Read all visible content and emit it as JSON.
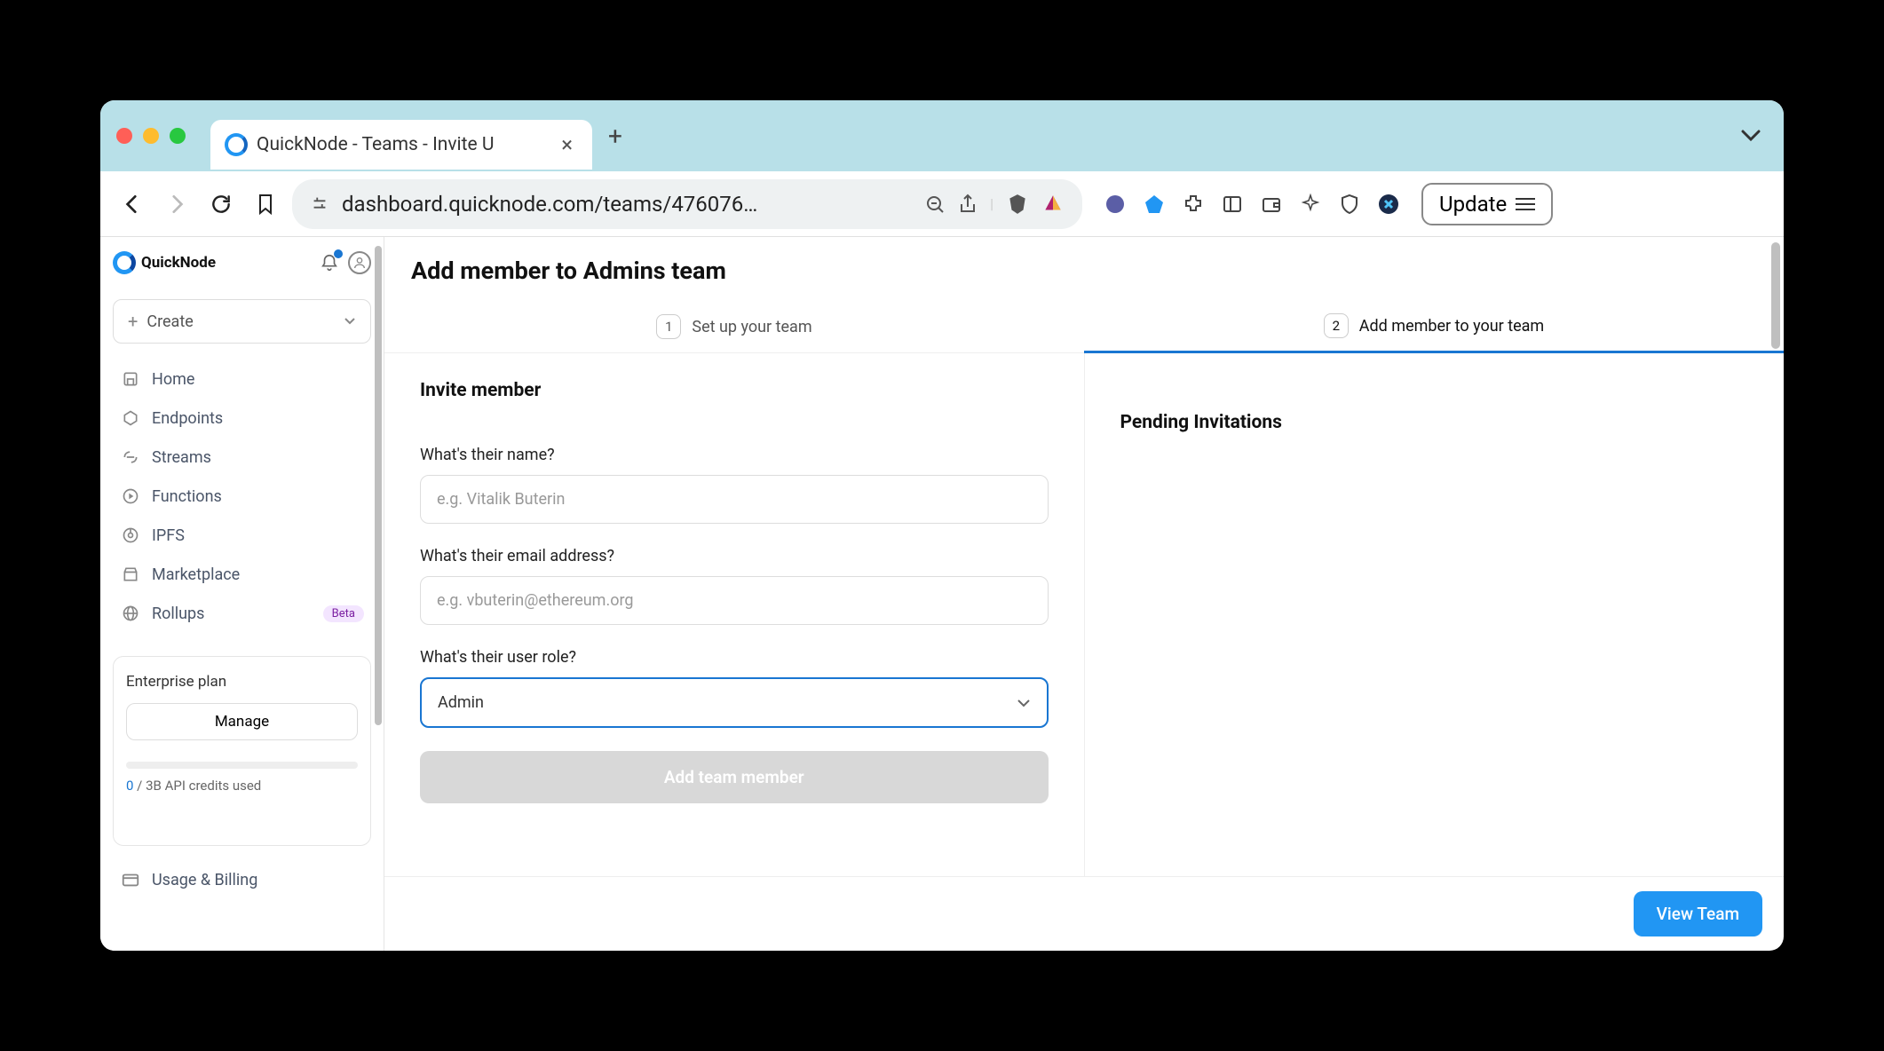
{
  "browser": {
    "tab_title": "QuickNode - Teams - Invite U",
    "url": "dashboard.quicknode.com/teams/476076…",
    "update_label": "Update"
  },
  "sidebar": {
    "brand": "QuickNode",
    "create_label": "Create",
    "nav": [
      {
        "label": "Home",
        "icon": "home"
      },
      {
        "label": "Endpoints",
        "icon": "hexagon"
      },
      {
        "label": "Streams",
        "icon": "stream"
      },
      {
        "label": "Functions",
        "icon": "play"
      },
      {
        "label": "IPFS",
        "icon": "ipfs"
      },
      {
        "label": "Marketplace",
        "icon": "store"
      },
      {
        "label": "Rollups",
        "icon": "globe",
        "badge": "Beta"
      }
    ],
    "plan": {
      "title": "Enterprise plan",
      "manage_label": "Manage",
      "credits_used_prefix": "0",
      "credits_used_rest": " / 3B API credits used"
    },
    "usage_billing": "Usage & Billing"
  },
  "page": {
    "title": "Add member to Admins team",
    "steps": [
      {
        "num": "1",
        "label": "Set up your team"
      },
      {
        "num": "2",
        "label": "Add member to your team"
      }
    ],
    "invite": {
      "section_title": "Invite member",
      "name_label": "What's their name?",
      "name_placeholder": "e.g. Vitalik Buterin",
      "email_label": "What's their email address?",
      "email_placeholder": "e.g. vbuterin@ethereum.org",
      "role_label": "What's their user role?",
      "role_value": "Admin",
      "add_button": "Add team member"
    },
    "pending_title": "Pending Invitations",
    "view_team": "View Team"
  }
}
